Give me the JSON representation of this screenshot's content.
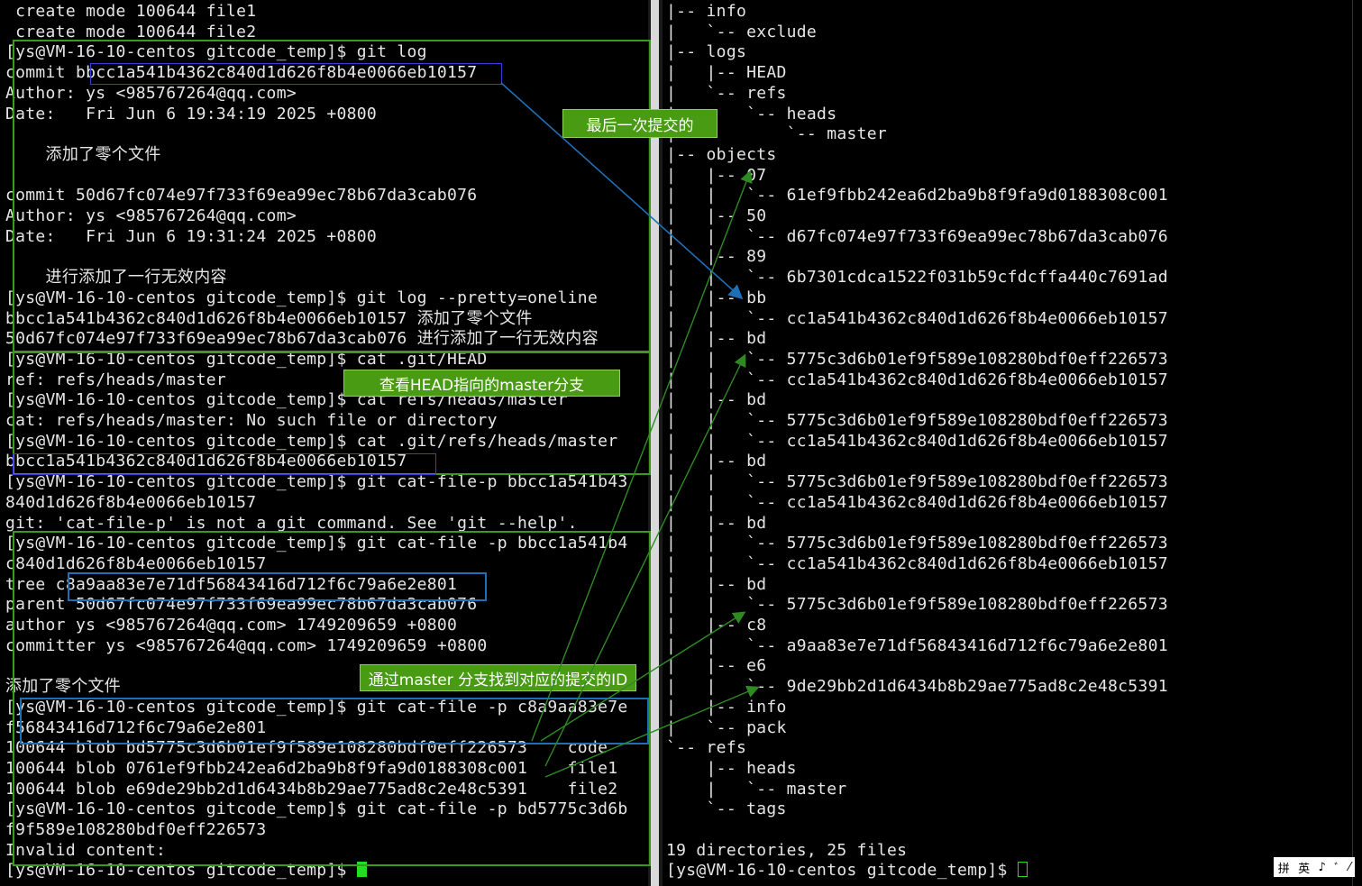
{
  "left_terminal": {
    "lines": [
      " create mode 100644 file1",
      " create mode 100644 file2",
      "[ys@VM-16-10-centos gitcode_temp]$ git log",
      "commit bbcc1a541b4362c840d1d626f8b4e0066eb10157",
      "Author: ys <985767264@qq.com>",
      "Date:   Fri Jun 6 19:34:19 2025 +0800",
      "",
      "    添加了零个文件",
      "",
      "commit 50d67fc074e97f733f69ea99ec78b67da3cab076",
      "Author: ys <985767264@qq.com>",
      "Date:   Fri Jun 6 19:31:24 2025 +0800",
      "",
      "    进行添加了一行无效内容",
      "[ys@VM-16-10-centos gitcode_temp]$ git log --pretty=oneline",
      "bbcc1a541b4362c840d1d626f8b4e0066eb10157 添加了零个文件",
      "50d67fc074e97f733f69ea99ec78b67da3cab076 进行添加了一行无效内容",
      "[ys@VM-16-10-centos gitcode_temp]$ cat .git/HEAD",
      "ref: refs/heads/master",
      "[ys@VM-16-10-centos gitcode_temp]$ cat refs/heads/master",
      "cat: refs/heads/master: No such file or directory",
      "[ys@VM-16-10-centos gitcode_temp]$ cat .git/refs/heads/master",
      "bbcc1a541b4362c840d1d626f8b4e0066eb10157",
      "[ys@VM-16-10-centos gitcode_temp]$ git cat-file-p bbcc1a541b43",
      "840d1d626f8b4e0066eb10157",
      "git: 'cat-file-p' is not a git command. See 'git --help'.",
      "[ys@VM-16-10-centos gitcode_temp]$ git cat-file -p bbcc1a541b4",
      "c840d1d626f8b4e0066eb10157",
      "tree c8a9aa83e7e71df56843416d712f6c79a6e2e801",
      "parent 50d67fc074e97f733f69ea99ec78b67da3cab076",
      "author ys <985767264@qq.com> 1749209659 +0800",
      "committer ys <985767264@qq.com> 1749209659 +0800",
      "",
      "添加了零个文件",
      "[ys@VM-16-10-centos gitcode_temp]$ git cat-file -p c8a9aa83e7e",
      "f56843416d712f6c79a6e2e801",
      "100644 blob bd5775c3d6b01ef9f589e108280bdf0eff226573    code",
      "100644 blob 0761ef9fbb242ea6d2ba9b8f9fa9d0188308c001    file1",
      "100644 blob e69de29bb2d1d6434b8b29ae775ad8c2e48c5391    file2",
      "[ys@VM-16-10-centos gitcode_temp]$ git cat-file -p bd5775c3d6b",
      "f9f589e108280bdf0eff226573",
      "Invalid content:",
      "[ys@VM-16-10-centos gitcode_temp]$ "
    ]
  },
  "right_terminal": {
    "lines": [
      "|-- info",
      "|   `-- exclude",
      "|-- logs",
      "|   |-- HEAD",
      "|   `-- refs",
      "|       `-- heads",
      "|           `-- master",
      "|-- objects",
      "|   |-- 07",
      "|   |   `-- 61ef9fbb242ea6d2ba9b8f9fa9d0188308c001",
      "|   |-- 50",
      "|   |   `-- d67fc074e97f733f69ea99ec78b67da3cab076",
      "|   |-- 89",
      "|   |   `-- 6b7301cdca1522f031b59cfdcffa440c7691ad",
      "|   |-- bb",
      "|   |   `-- cc1a541b4362c840d1d626f8b4e0066eb10157",
      "|   |-- bd",
      "|   |   `-- 5775c3d6b01ef9f589e108280bdf0eff226573",
      "|   |   `-- cc1a541b4362c840d1d626f8b4e0066eb10157",
      "|   |-- bd",
      "|   |   `-- 5775c3d6b01ef9f589e108280bdf0eff226573",
      "|   |   `-- cc1a541b4362c840d1d626f8b4e0066eb10157",
      "|   |-- bd",
      "|   |   `-- 5775c3d6b01ef9f589e108280bdf0eff226573",
      "|   |   `-- cc1a541b4362c840d1d626f8b4e0066eb10157",
      "|   |-- bd",
      "|   |   `-- 5775c3d6b01ef9f589e108280bdf0eff226573",
      "|   |   `-- cc1a541b4362c840d1d626f8b4e0066eb10157",
      "|   |-- bd",
      "|   |   `-- 5775c3d6b01ef9f589e108280bdf0eff226573",
      "|   |-- c8",
      "|   |   `-- a9aa83e7e71df56843416d712f6c79a6e2e801",
      "|   |-- e6",
      "|   |   `-- 9de29bb2d1d6434b8b29ae775ad8c2e48c5391",
      "|   |-- info",
      "|   `-- pack",
      "`-- refs",
      "    |-- heads",
      "    |   `-- master",
      "    `-- tags",
      "",
      "19 directories, 25 files",
      "[ys@VM-16-10-centos gitcode_temp]$ "
    ]
  },
  "annotations": {
    "last_commit": "最后一次提交的",
    "head_master": "查看HEAD指向的master分支",
    "find_commit": "通过master 分支找到对应的提交的ID"
  },
  "ime_toolbar": {
    "items": [
      "拼",
      "英",
      "♪",
      "ﾞ",
      "⁄"
    ]
  },
  "colors": {
    "terminal_bg": "#000000",
    "text": "#e6e6e6",
    "box_green": "#3a9a1a",
    "box_blue": "#1f6fb5",
    "label_bg": "#4a9b14",
    "cursor": "#22dd22"
  }
}
